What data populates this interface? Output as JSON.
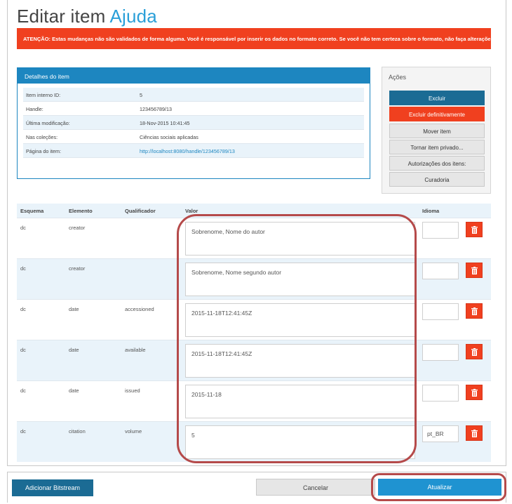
{
  "page": {
    "title_prefix": "Editar item",
    "title_accent": "Ajuda",
    "warning": "ATENÇÃO: Estas mudanças não são validados de forma alguma. Você é responsável por inserir os dados no formato correto. Se você não tem certeza sobre o formato, não faça alterações."
  },
  "details": {
    "header": "Detalhes do item",
    "rows": [
      {
        "label": "Item interno ID:",
        "value": "5"
      },
      {
        "label": "Handle:",
        "value": "123456789/13"
      },
      {
        "label": "Última modificação:",
        "value": "18-Nov-2015 10:41:45"
      },
      {
        "label": "Nas coleções:",
        "value": "Ciências sociais aplicadas"
      },
      {
        "label": "Página do item:",
        "value": "http://localhost:8080/handle/123456789/13"
      }
    ]
  },
  "actions": {
    "title": "Ações",
    "buttons": [
      "Excluir",
      "Excluir definitivamente",
      "Mover item",
      "Tornar item privado...",
      "Autorizações dos itens:",
      "Curadoria"
    ]
  },
  "metadata": {
    "headers": {
      "schema": "Esquema",
      "element": "Elemento",
      "qualifier": "Qualificador",
      "value": "Valor",
      "language": "Idioma"
    },
    "rows": [
      {
        "schema": "dc",
        "element": "creator",
        "qualifier": "",
        "value": "Sobrenome, Nome do autor",
        "language": ""
      },
      {
        "schema": "dc",
        "element": "creator",
        "qualifier": "",
        "value": "Sobrenome, Nome segundo autor",
        "language": ""
      },
      {
        "schema": "dc",
        "element": "date",
        "qualifier": "accessioned",
        "value": "2015-11-18T12:41:45Z",
        "language": ""
      },
      {
        "schema": "dc",
        "element": "date",
        "qualifier": "available",
        "value": "2015-11-18T12:41:45Z",
        "language": ""
      },
      {
        "schema": "dc",
        "element": "date",
        "qualifier": "issued",
        "value": "2015-11-18",
        "language": ""
      },
      {
        "schema": "dc",
        "element": "citation",
        "qualifier": "volume",
        "value": "5",
        "language": "pt_BR"
      }
    ]
  },
  "footer": {
    "add_bitstream": "Adicionar Bitstream",
    "cancel": "Cancelar",
    "update": "Atualizar"
  },
  "colors": {
    "accent": "#2a9fd8",
    "danger": "#f0401f",
    "primary": "#1b6b94",
    "highlight": "#b54a4a"
  }
}
